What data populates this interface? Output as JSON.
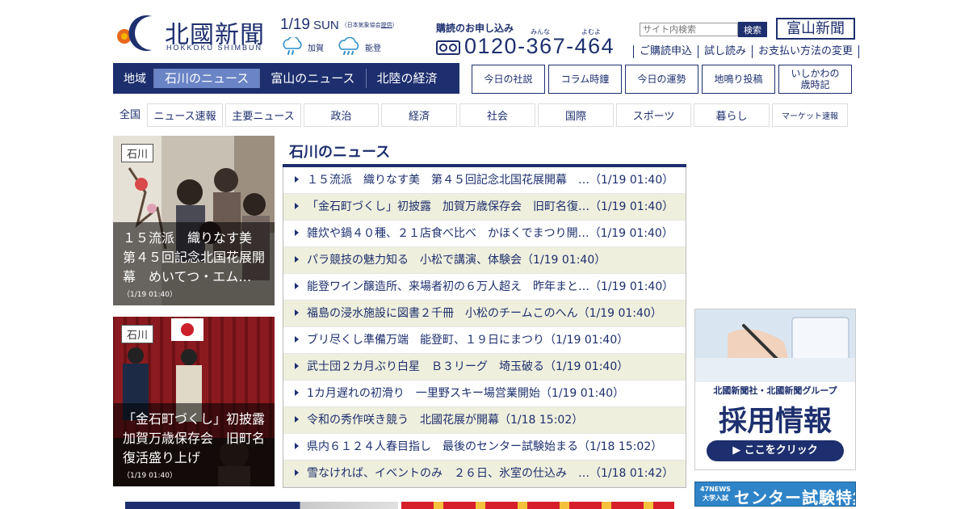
{
  "header": {
    "logo_title": "北國新聞",
    "logo_sub": "HOKKOKU SHIMBUN",
    "date": "1/19",
    "dow": "SUN",
    "weather_src_prefix": "（日本気象協会",
    "weather_src_link": "提供",
    "weather_src_suffix": "）",
    "weather": [
      {
        "area": "加賀",
        "icon": "rain-icon"
      },
      {
        "area": "能登",
        "icon": "cloud-rain-icon"
      }
    ],
    "subscribe_label": "購読のお申し込み",
    "ruby": [
      "みんな",
      "よむよ"
    ],
    "phone": "0120-367-464",
    "search_placeholder": "サイト内検索",
    "search_button": "検索",
    "toyama_logo": "富山新聞",
    "links": [
      "ご購読申込",
      "試し読み",
      "お支払い方法の変更"
    ]
  },
  "region_nav": {
    "label": "地域",
    "tabs": [
      {
        "label": "石川のニュース",
        "active": true
      },
      {
        "label": "富山のニュース",
        "active": false
      },
      {
        "label": "北陸の経済",
        "active": false
      }
    ]
  },
  "buttons": [
    "今日の社説",
    "コラム時鐘",
    "今日の運勢",
    "地鳴り投稿",
    "いしかわの\n歳時記"
  ],
  "cat_nav": {
    "label": "全国",
    "items": [
      "ニュース速報",
      "主要ニュース",
      "政治",
      "経済",
      "社会",
      "国際",
      "スポーツ",
      "暮らし",
      "マーケット速報"
    ]
  },
  "featured": [
    {
      "tag": "石川",
      "title": "１５流派　織りなす美　第４５回記念北国花展開幕　めいてつ・エム…",
      "date": "（1/19 01:40）"
    },
    {
      "tag": "石川",
      "title": "「金石町づくし」初披露　加賀万歳保存会　旧町名復活盛り上げ",
      "date": "（1/19 01:40）"
    }
  ],
  "news": {
    "title": "石川のニュース",
    "items": [
      "１５流派　織りなす美　第４５回記念北国花展開幕　…（1/19 01:40）",
      "「金石町づくし」初披露　加賀万歳保存会　旧町名復…（1/19 01:40）",
      "雑炊や鍋４０種、２１店食べ比べ　かほくでまつり開…（1/19 01:40）",
      "パラ競技の魅力知る　小松で講演、体験会（1/19 01:40）",
      "能登ワイン醸造所、来場者初の６万人超え　昨年まと…（1/19 01:40）",
      "福島の浸水施設に図書２千冊　小松のチームこのへん（1/19 01:40）",
      "ブリ尽くし準備万端　能登町、１９日にまつり（1/19 01:40）",
      "武士団２カ月ぶり白星　Ｂ３リーグ　埼玉破る（1/19 01:40）",
      "1カ月遅れの初滑り　一里野スキー場営業開始（1/19 01:40）",
      "令和の秀作咲き競う　北國花展が開幕（1/18 15:02）",
      "県内６１２４人春目指し　最後のセンター試験始まる（1/18 15:02）",
      "雪なければ、イベントのみ　２６日、氷室の仕込み　…（1/18 01:42）"
    ]
  },
  "ads": {
    "recruit_sub": "北國新聞社・北國新聞グループ",
    "recruit_main": "採用情報",
    "recruit_cta": "▶ ここをクリック",
    "exam_badge_top": "47NEWS",
    "exam_badge_bottom": "大学入試",
    "exam_title": "センター試験特集"
  },
  "colors": {
    "brand": "#1d2f6e",
    "active_tab": "#6a84c6",
    "row_alt": "#efefdd"
  }
}
